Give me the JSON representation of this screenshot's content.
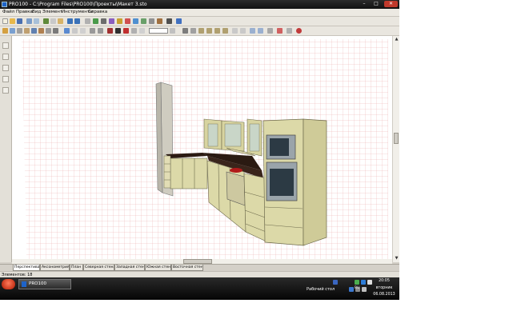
{
  "window": {
    "title": "PRO100 - C:\\Program Files\\PRO100\\Проекты\\Макет 3.sto",
    "controls": {
      "minimize": "–",
      "maximize": "□",
      "close": "✕"
    }
  },
  "menu": [
    "Файл",
    "Правка",
    "Вид",
    "Элемент",
    "Инструменты",
    "Справка"
  ],
  "toolbar": {
    "zoom_value": ""
  },
  "view_tabs": [
    "Перспектива",
    "Аксонометрия",
    "План",
    "Северная стена",
    "Западная стена",
    "Южная стена",
    "Восточная стена"
  ],
  "status": {
    "elements": "Элементов: 18"
  },
  "taskbar": {
    "app_label": "PRO100",
    "desktop_label": "Рабочий стол",
    "lang": "RU",
    "time": "20:05",
    "weekday": "вторник",
    "date": "06.08.2013"
  },
  "colors": {
    "grid": "#e9a4a4",
    "cabinet": "#dcd9a8",
    "countertop": "#2b1a12",
    "appliance": "#9aa4aa",
    "wall_unit": "#d8d4a0"
  }
}
